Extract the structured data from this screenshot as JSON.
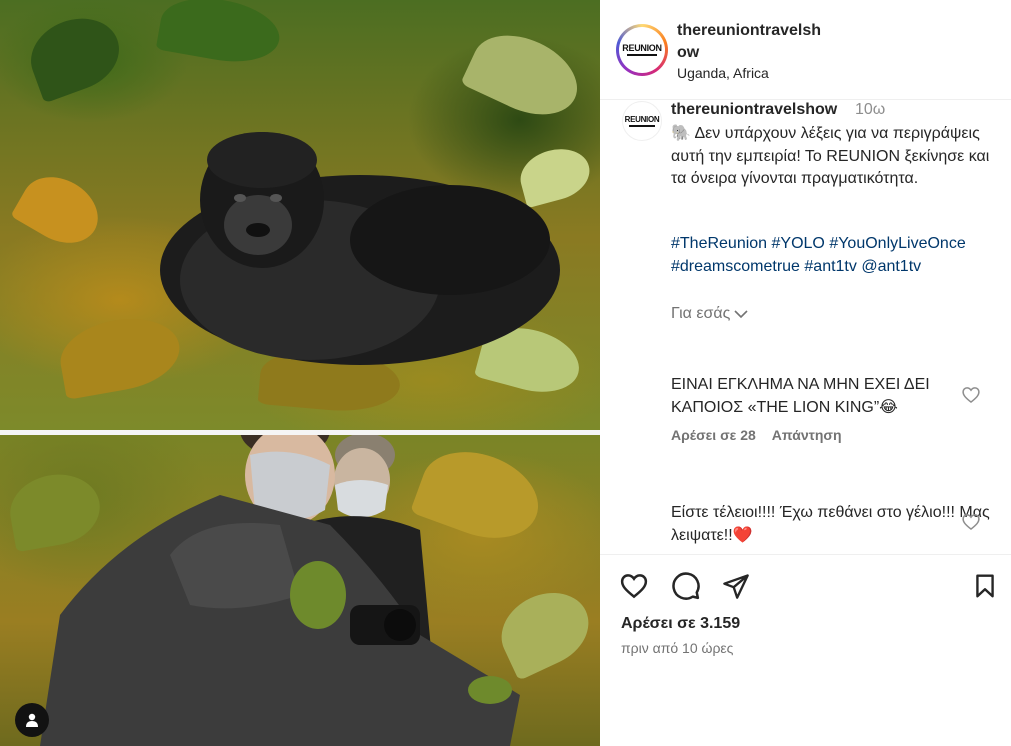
{
  "post": {
    "account": {
      "username_line1": "thereuniontravelsh",
      "username_line2": "ow",
      "location": "Uganda, Africa",
      "logo_text": "REUNION"
    },
    "caption": {
      "username": "thereuniontravelshow",
      "time": "10ω",
      "text": "🐘 Δεν υπάρχουν λέξεις για να περιγράψεις αυτή την εμπειρία! Το REUNION ξεκίνησε και τα όνειρα γίνονται πραγματικότητα.",
      "hashtags": "#TheReunion #YOLO #YouOnlyLiveOnce #dreamscometrue #ant1tv @ant1tv",
      "translate_label": "Για εσάς"
    },
    "comments": [
      {
        "text": "ΕΙΝΑΙ ΕΓΚΛΗΜΑ ΝΑ ΜΗΝ ΕΧΕΙ ΔΕΙ ΚΑΠΟΙΟΣ «THE LION KING”😂",
        "likes_label": "Αρέσει σε 28",
        "reply_label": "Απάντηση"
      },
      {
        "text": "Είστε τέλειοι!!!! Έχω πεθάνει στο γέλιο!!! Μας λειψατε!!❤️"
      }
    ],
    "actions": {
      "like_icon": "heart-outline-icon",
      "comment_icon": "comment-bubble-icon",
      "share_icon": "paper-plane-icon",
      "save_icon": "bookmark-icon"
    },
    "likes_text": "Αρέσει σε 3.159",
    "posted_time": "πριν από 10 ώρες"
  },
  "colors": {
    "hashtag": "#00376b",
    "muted": "#737373",
    "text": "#262626",
    "heart_red": "#ed4956"
  }
}
